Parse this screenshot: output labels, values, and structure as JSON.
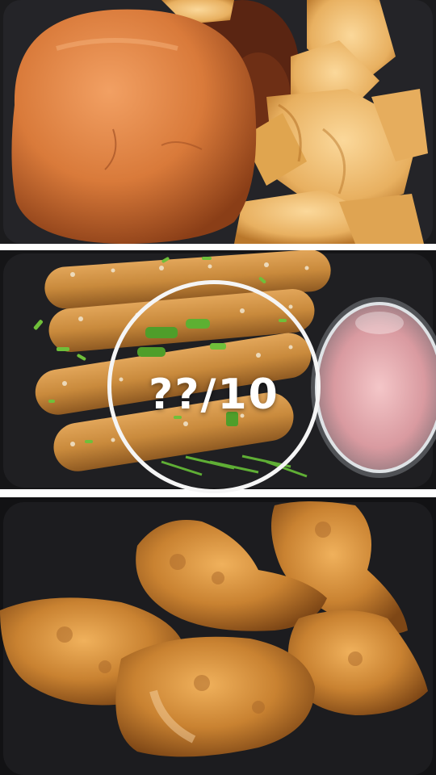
{
  "overlay": {
    "rating_text": "??/10"
  },
  "panels": [
    {
      "subject": "burger-with-chips"
    },
    {
      "subject": "mozzarella-sticks-with-sauce-cup"
    },
    {
      "subject": "fried-chicken-wings"
    }
  ],
  "colors": {
    "divider": "#ffffff",
    "ring": "#f5f5f5",
    "container": "#1b1b1d",
    "bun": "#d97a3a",
    "chip": "#e8b060",
    "stick": "#c98a3c",
    "herb": "#6fbf3a",
    "wing": "#c98231"
  }
}
